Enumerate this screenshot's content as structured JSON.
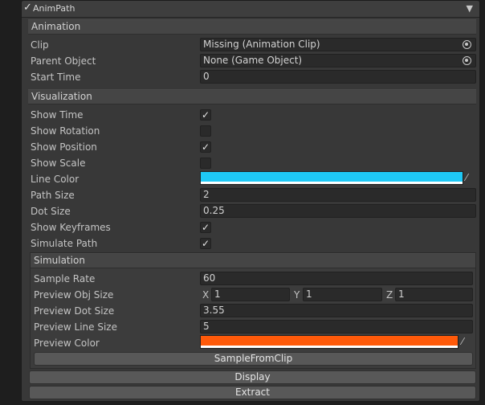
{
  "component": {
    "enabled_check": "✓",
    "title": "AnimPath",
    "menu_icon": "▼"
  },
  "animation": {
    "header": "Animation",
    "clip": {
      "label": "Clip",
      "value": "Missing (Animation Clip)"
    },
    "parent": {
      "label": "Parent Object",
      "value": "None (Game Object)"
    },
    "start_time": {
      "label": "Start Time",
      "value": "0"
    }
  },
  "visualization": {
    "header": "Visualization",
    "show_time": {
      "label": "Show Time",
      "checked": true
    },
    "show_rotation": {
      "label": "Show Rotation",
      "checked": false
    },
    "show_position": {
      "label": "Show Position",
      "checked": true
    },
    "show_scale": {
      "label": "Show Scale",
      "checked": false
    },
    "line_color": {
      "label": "Line Color",
      "color": "#1ec8f5"
    },
    "path_size": {
      "label": "Path Size",
      "value": "2"
    },
    "dot_size": {
      "label": "Dot Size",
      "value": "0.25"
    },
    "show_keyframes": {
      "label": "Show Keyframes",
      "checked": true
    },
    "simulate_path": {
      "label": "Simulate Path",
      "checked": true
    }
  },
  "simulation": {
    "header": "Simulation",
    "sample_rate": {
      "label": "Sample Rate",
      "value": "60"
    },
    "preview_obj_size": {
      "label": "Preview Obj Size",
      "x_label": "X",
      "x": "1",
      "y_label": "Y",
      "y": "1",
      "z_label": "Z",
      "z": "1"
    },
    "preview_dot_size": {
      "label": "Preview Dot Size",
      "value": "3.55"
    },
    "preview_line_size": {
      "label": "Preview Line Size",
      "value": "5"
    },
    "preview_color": {
      "label": "Preview Color",
      "color": "#ff5a0a"
    },
    "sample_button": "SampleFromClip"
  },
  "buttons": {
    "display": "Display",
    "extract": "Extract"
  },
  "check_glyph": "✓",
  "icons": {
    "object_picker": "object-picker-icon",
    "eyedropper": "eyedropper-icon"
  }
}
